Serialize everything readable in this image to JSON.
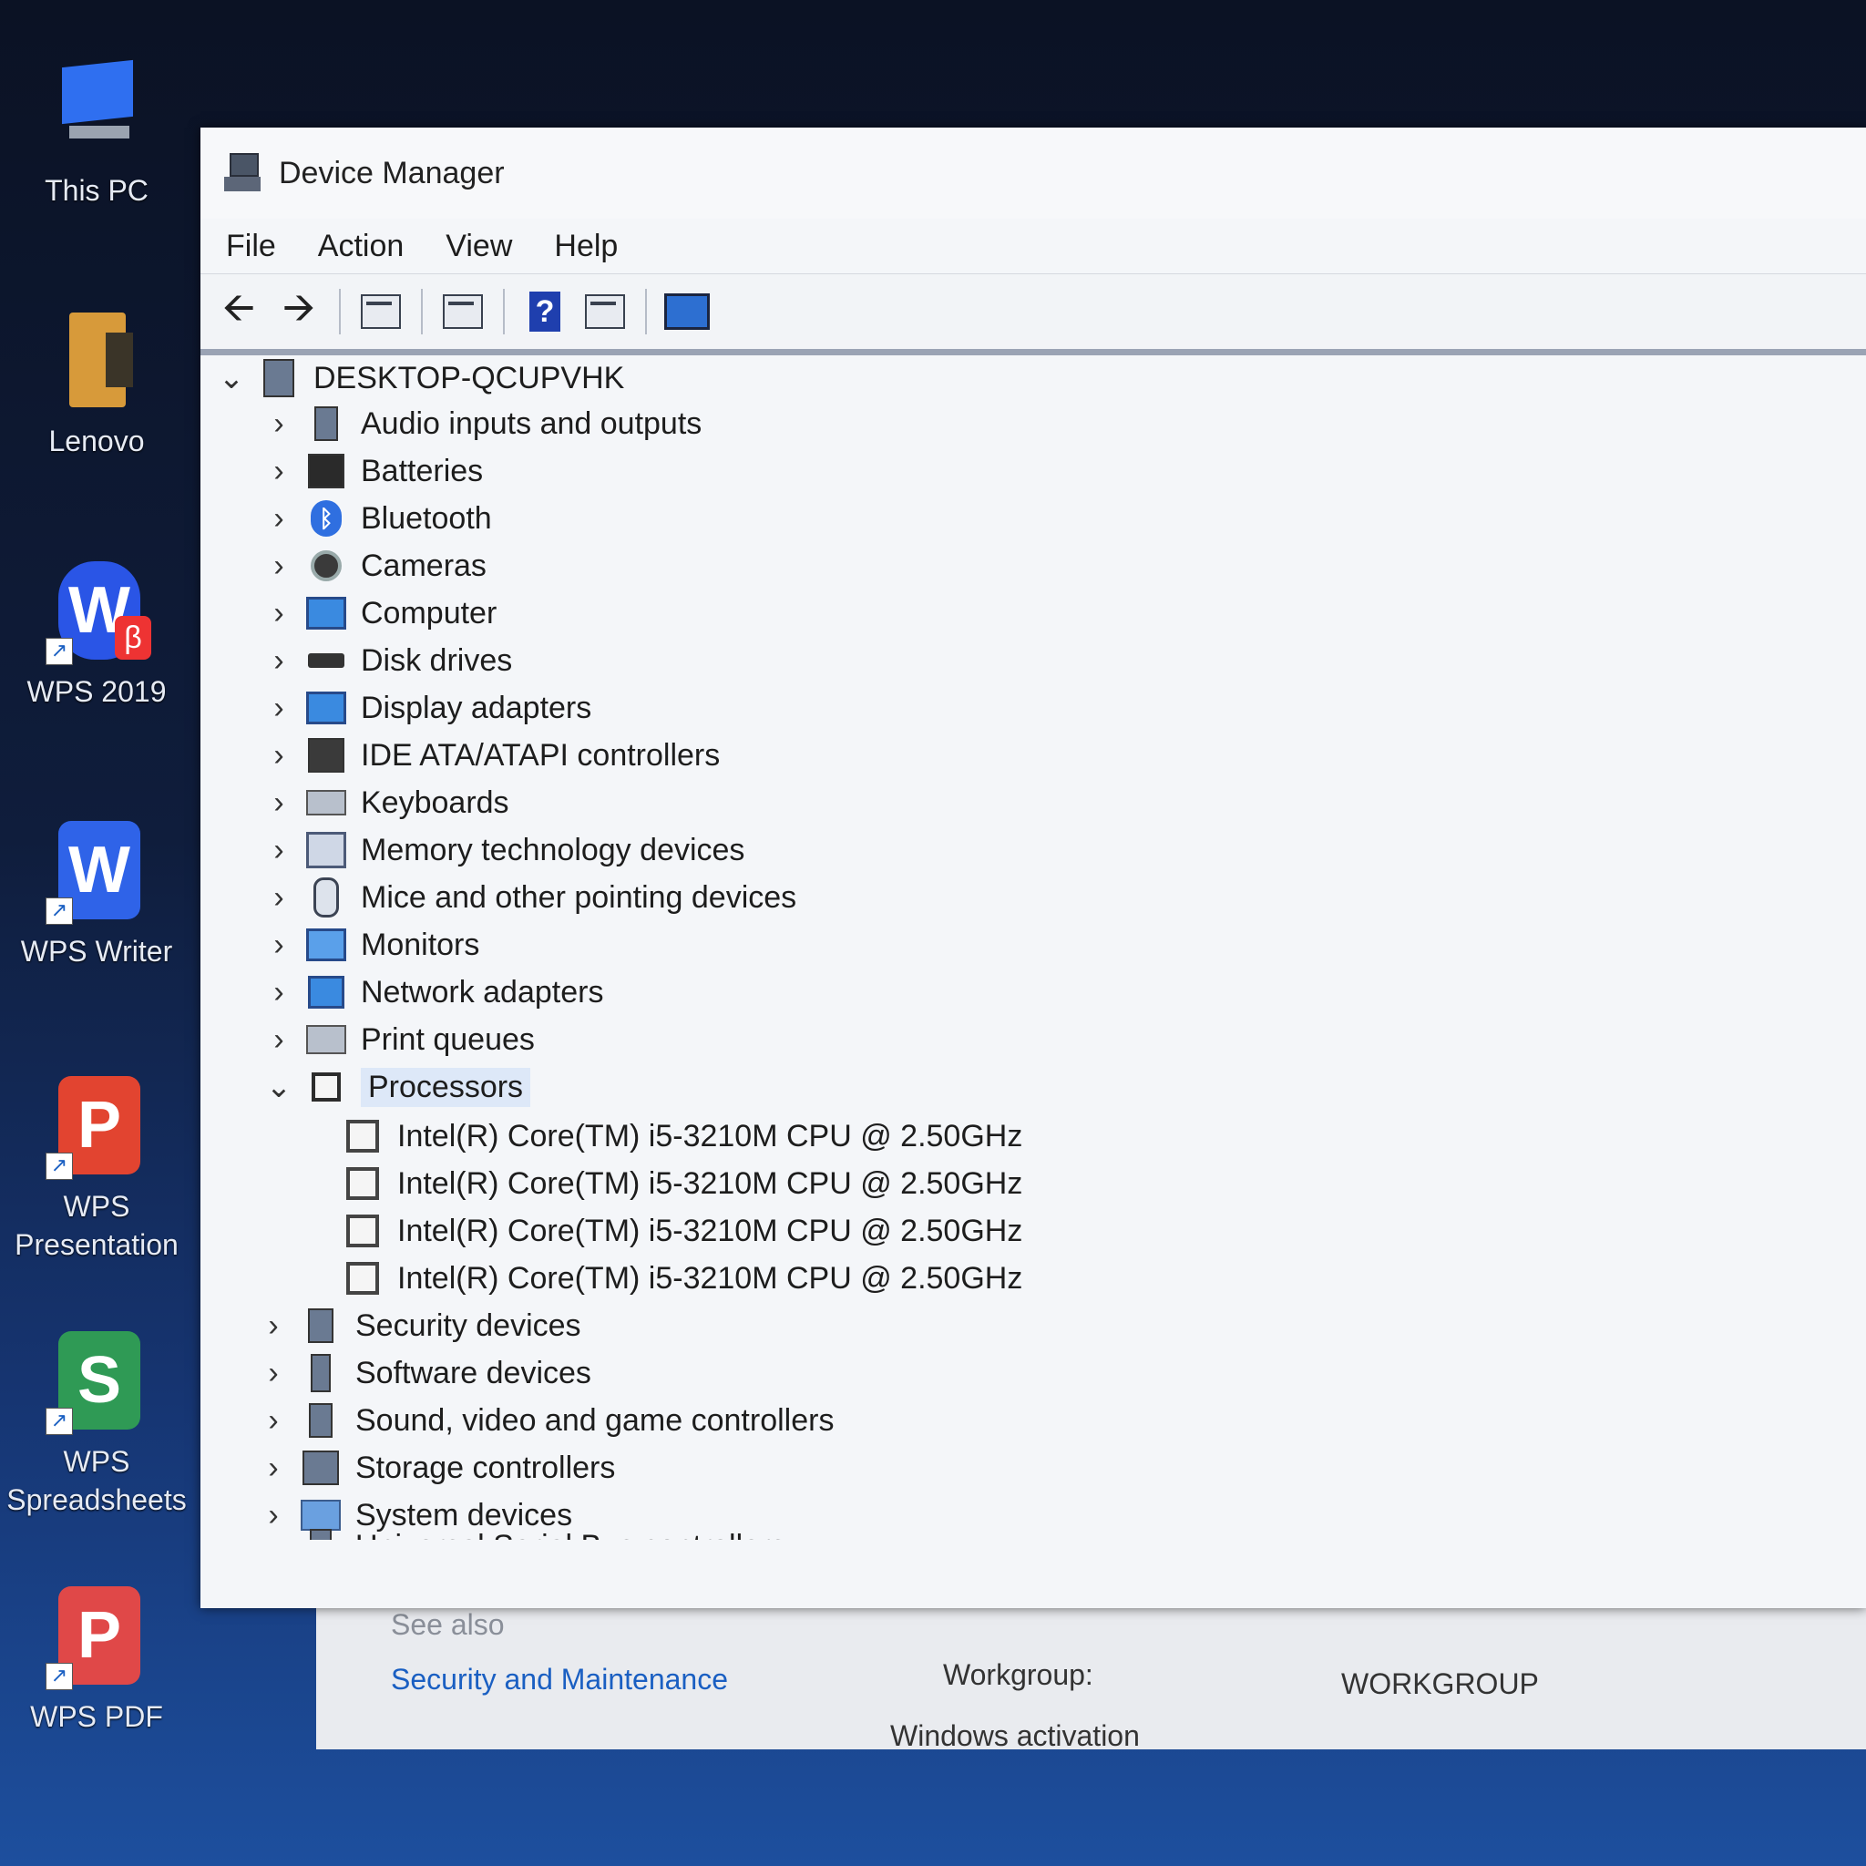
{
  "desktop": {
    "icons": [
      {
        "label": "This PC",
        "icon": "computer-icon"
      },
      {
        "label": "Lenovo",
        "icon": "folder-icon"
      },
      {
        "label": "WPS 2019",
        "icon": "wps-office-icon",
        "glyph": "W",
        "badge": "β",
        "color": "#2a55e6"
      },
      {
        "label": "WPS Writer",
        "icon": "wps-writer-icon",
        "glyph": "W",
        "color": "#2f63e8"
      },
      {
        "label": "WPS Presentation",
        "icon": "wps-presentation-icon",
        "glyph": "P",
        "color": "#e24430"
      },
      {
        "label": "WPS Spreadsheets",
        "icon": "wps-spreadsheets-icon",
        "glyph": "S",
        "color": "#2f9a55"
      },
      {
        "label": "WPS PDF",
        "icon": "wps-pdf-icon",
        "glyph": "P",
        "color": "#e04848"
      }
    ]
  },
  "window": {
    "title": "Device Manager",
    "menu": [
      "File",
      "Action",
      "View",
      "Help"
    ]
  },
  "tree": {
    "root": "DESKTOP-QCUPVHK",
    "categories": [
      "Audio inputs and outputs",
      "Batteries",
      "Bluetooth",
      "Cameras",
      "Computer",
      "Disk drives",
      "Display adapters",
      "IDE ATA/ATAPI controllers",
      "Keyboards",
      "Memory technology devices",
      "Mice and other pointing devices",
      "Monitors",
      "Network adapters",
      "Print queues",
      "Processors"
    ],
    "processors": [
      "Intel(R) Core(TM) i5-3210M CPU @ 2.50GHz",
      "Intel(R) Core(TM) i5-3210M CPU @ 2.50GHz",
      "Intel(R) Core(TM) i5-3210M CPU @ 2.50GHz",
      "Intel(R) Core(TM) i5-3210M CPU @ 2.50GHz"
    ],
    "after": [
      "Security devices",
      "Software devices",
      "Sound, video and game controllers",
      "Storage controllers",
      "System devices",
      "Universal Serial Bus controllers"
    ]
  },
  "control_panel": {
    "see_also": "See also",
    "security_link": "Security and Maintenance",
    "workgroup_label": "Workgroup:",
    "workgroup_value": "WORKGROUP",
    "activation": "Windows activation"
  }
}
